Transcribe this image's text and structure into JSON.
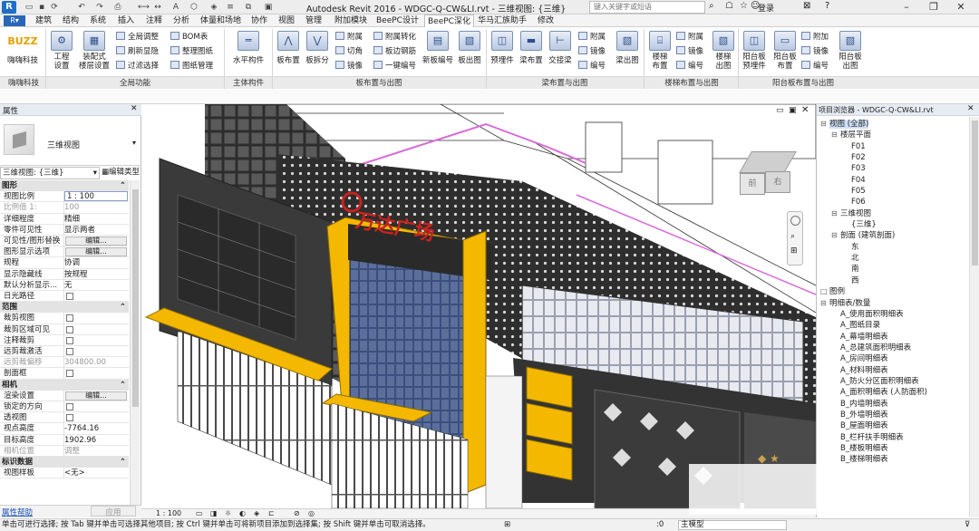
{
  "titlebar": {
    "title": "Autodesk Revit 2016 -    WDGC-Q-CW&LI.rvt - 三维视图: {三维}",
    "search_placeholder": "键入关键字或短语",
    "user": "登录",
    "help": "?"
  },
  "tabs": [
    "建筑",
    "结构",
    "系统",
    "插入",
    "注释",
    "分析",
    "体量和场地",
    "协作",
    "视图",
    "管理",
    "附加模块",
    "BeePC设计",
    "BeePC深化",
    "华马汇族助手",
    "修改"
  ],
  "ribbon": {
    "panels": [
      {
        "title": "嗨嗨科技",
        "big": [
          {
            "label": "嗨嗨科技",
            "icon": "BUZZ"
          }
        ]
      },
      {
        "title": "全局功能",
        "big": [
          {
            "label": "工程\n设置"
          },
          {
            "label": "装配式\n楼层设置"
          }
        ],
        "small": [
          "全局调整",
          "刷新显隐",
          "过滤选择",
          "BOM表",
          "整理图纸",
          "图纸管理"
        ]
      },
      {
        "title": "主体构件",
        "big": [
          {
            "label": "水平构件"
          }
        ]
      },
      {
        "title": "板布置与出图",
        "big": [
          {
            "label": "板布置"
          },
          {
            "label": "板拆分"
          },
          {
            "label": "新板编号"
          },
          {
            "label": "板出图"
          }
        ],
        "small": [
          "附属",
          "切角",
          "镜像",
          "附属转化",
          "板边钢筋",
          "一键编号"
        ]
      },
      {
        "title": "梁布置与出图",
        "big": [
          {
            "label": "预埋件"
          },
          {
            "label": "梁布置"
          },
          {
            "label": "交接梁"
          },
          {
            "label": "梁出图"
          }
        ],
        "small": [
          "附属",
          "镜像",
          "编号"
        ]
      },
      {
        "title": "楼梯布置与出图",
        "big": [
          {
            "label": "楼梯\n布置"
          },
          {
            "label": "楼梯\n出图"
          }
        ],
        "small": [
          "附属",
          "镜像",
          "编号"
        ]
      },
      {
        "title": "阳台板布置与出图",
        "big": [
          {
            "label": "阳台板\n预埋件"
          },
          {
            "label": "阳台板\n布置"
          },
          {
            "label": "阳台板\n出图"
          }
        ],
        "small": [
          "附加",
          "镜像",
          "编号"
        ]
      }
    ]
  },
  "properties": {
    "header": "属性",
    "type_name": "三维视图",
    "selector": "三维视图: {三维}",
    "edit_type": "编辑类型",
    "groups": [
      {
        "name": "图形",
        "rows": [
          {
            "name": "视图比例",
            "value": "1 : 100",
            "kind": "input"
          },
          {
            "name": "比例值 1:",
            "value": "100",
            "kind": "gray"
          },
          {
            "name": "详细程度",
            "value": "精细"
          },
          {
            "name": "零件可见性",
            "value": "显示两者"
          },
          {
            "name": "可见性/图形替换",
            "value": "编辑...",
            "kind": "button"
          },
          {
            "name": "图形显示选项",
            "value": "编辑...",
            "kind": "button"
          },
          {
            "name": "规程",
            "value": "协调"
          },
          {
            "name": "显示隐藏线",
            "value": "按规程"
          },
          {
            "name": "默认分析显示...",
            "value": "无"
          },
          {
            "name": "日光路径",
            "value": "",
            "kind": "check"
          }
        ]
      },
      {
        "name": "范围",
        "rows": [
          {
            "name": "裁剪视图",
            "value": "",
            "kind": "check"
          },
          {
            "name": "裁剪区域可见",
            "value": "",
            "kind": "check"
          },
          {
            "name": "注释裁剪",
            "value": "",
            "kind": "check"
          },
          {
            "name": "远剪裁激活",
            "value": "",
            "kind": "check"
          },
          {
            "name": "远剪裁偏移",
            "value": "304800.00",
            "kind": "gray"
          },
          {
            "name": "剖面框",
            "value": "",
            "kind": "check"
          }
        ]
      },
      {
        "name": "相机",
        "rows": [
          {
            "name": "渲染设置",
            "value": "编辑...",
            "kind": "button"
          },
          {
            "name": "锁定的方向",
            "value": "",
            "kind": "check"
          },
          {
            "name": "透视图",
            "value": "",
            "kind": "check"
          },
          {
            "name": "视点高度",
            "value": "-7764.16"
          },
          {
            "name": "目标高度",
            "value": "1902.96"
          },
          {
            "name": "相机位置",
            "value": "调整",
            "kind": "gray"
          }
        ]
      },
      {
        "name": "标识数据",
        "rows": [
          {
            "name": "视图样板",
            "value": "<无>"
          }
        ]
      }
    ],
    "help_link": "属性帮助",
    "apply": "应用"
  },
  "viewport": {
    "scale_label": "1 : 100",
    "viewcube_front": "前",
    "viewcube_right": "右",
    "sign_text": "万达广场"
  },
  "browser": {
    "title": "项目浏览器 - WDGC-Q-CW&LI.rvt",
    "tree": [
      {
        "label": "视图 (全部)",
        "level": 0,
        "exp": "−"
      },
      {
        "label": "楼层平面",
        "level": 1,
        "exp": "−"
      },
      {
        "label": "F01",
        "level": 2
      },
      {
        "label": "F02",
        "level": 2
      },
      {
        "label": "F03",
        "level": 2
      },
      {
        "label": "F04",
        "level": 2
      },
      {
        "label": "F05",
        "level": 2
      },
      {
        "label": "F06",
        "level": 2
      },
      {
        "label": "三维视图",
        "level": 1,
        "exp": "−"
      },
      {
        "label": "{三维}",
        "level": 2
      },
      {
        "label": "剖面 (建筑剖面)",
        "level": 1,
        "exp": "−"
      },
      {
        "label": "东",
        "level": 2
      },
      {
        "label": "北",
        "level": 2
      },
      {
        "label": "南",
        "level": 2
      },
      {
        "label": "西",
        "level": 2
      },
      {
        "label": "图例",
        "level": 0,
        "exp": ""
      },
      {
        "label": "明细表/数量",
        "level": 0,
        "exp": "−"
      },
      {
        "label": "A_使用面积明细表",
        "level": 1
      },
      {
        "label": "A_图纸目录",
        "level": 1
      },
      {
        "label": "A_幕墙明细表",
        "level": 1
      },
      {
        "label": "A_总建筑面积明细表",
        "level": 1
      },
      {
        "label": "A_房间明细表",
        "level": 1
      },
      {
        "label": "A_材料明细表",
        "level": 1
      },
      {
        "label": "A_防火分区面积明细表",
        "level": 1
      },
      {
        "label": "A_面积明细表 (人防面积)",
        "level": 1
      },
      {
        "label": "B_内墙明细表",
        "level": 1
      },
      {
        "label": "B_外墙明细表",
        "level": 1
      },
      {
        "label": "B_屋面明细表",
        "level": 1
      },
      {
        "label": "B_栏杆扶手明细表",
        "level": 1
      },
      {
        "label": "B_楼板明细表",
        "level": 1
      },
      {
        "label": "B_楼梯明细表",
        "level": 1
      }
    ]
  },
  "status": {
    "message": "单击可进行选择; 按 Tab 键并单击可选择其他项目; 按 Ctrl 键并单击可将新项目添加到选择集; 按 Shift 键并单击可取消选择。",
    "model": "主模型",
    "coord": ":0"
  },
  "colors": {
    "accent": "#f5b800",
    "panel": "#3a3a3a",
    "glass": "#2c3e6e",
    "magenta": "#d86ad8"
  }
}
